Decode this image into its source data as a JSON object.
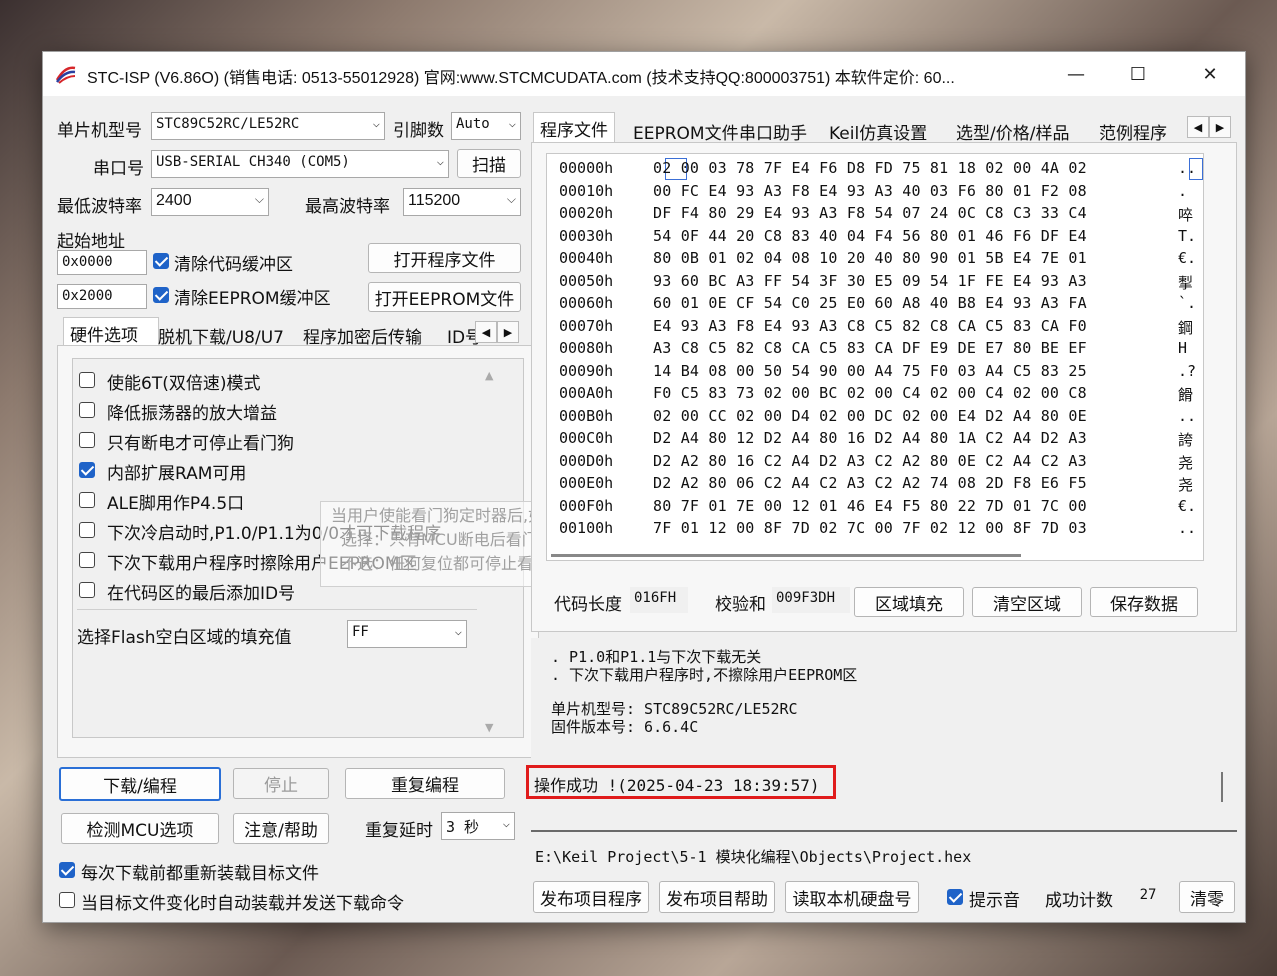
{
  "window": {
    "title": "STC-ISP (V6.86O) (销售电话: 0513-55012928) 官网:www.STCMCUDATA.com  (技术支持QQ:800003751) 本软件定价: 60...",
    "minimize": "—",
    "maximize": "☐",
    "close": "✕"
  },
  "left": {
    "mcu_label": "单片机型号",
    "mcu_value": "STC89C52RC/LE52RC",
    "pins_label": "引脚数",
    "pins_value": "Auto",
    "port_label": "串口号",
    "port_value": "USB-SERIAL CH340 (COM5)",
    "scan_button": "扫描",
    "min_baud_label": "最低波特率",
    "min_baud_value": "2400",
    "max_baud_label": "最高波特率",
    "max_baud_value": "115200",
    "start_addr_label": "起始地址",
    "addr1": "0x0000",
    "clear_code_label": "清除代码缓冲区",
    "open_prog_button": "打开程序文件",
    "addr2": "0x2000",
    "clear_eeprom_label": "清除EEPROM缓冲区",
    "open_eeprom_button": "打开EEPROM文件",
    "tabs": [
      "硬件选项",
      "脱机下载/U8/U7",
      "程序加密后传输",
      "ID号"
    ],
    "options": [
      {
        "label": "使能6T(双倍速)模式",
        "checked": false
      },
      {
        "label": "降低振荡器的放大增益",
        "checked": false
      },
      {
        "label": "只有断电才可停止看门狗",
        "checked": false
      },
      {
        "label": "内部扩展RAM可用",
        "checked": true
      },
      {
        "label": "ALE脚用作P4.5口",
        "checked": false
      },
      {
        "label": "下次冷启动时,P1.0/P1.1为0/0才可下载程序",
        "checked": false
      },
      {
        "label": "下次下载用户程序时擦除用户EEPROM区",
        "checked": false
      },
      {
        "label": "在代码区的最后添加ID号",
        "checked": false
      }
    ],
    "fill_label": "选择Flash空白区域的填充值",
    "fill_value": "FF",
    "tooltip_line1": "当用户使能看门狗定时器后,如何停止看门狗",
    "tooltip_line2": "选择：只有MCU断电后看门狗才停止",
    "tooltip_line3": "不选：任何复位都可停止看门狗",
    "download_button": "下载/编程",
    "stop_button": "停止",
    "reprogram_button": "重复编程",
    "detect_button": "检测MCU选项",
    "help_button": "注意/帮助",
    "delay_label": "重复延时",
    "delay_value": "3 秒",
    "reload_label": "每次下载前都重新装载目标文件",
    "auto_label": "当目标文件变化时自动装载并发送下载命令"
  },
  "right": {
    "tabs": [
      "程序文件",
      "EEPROM文件",
      "串口助手",
      "Keil仿真设置",
      "选型/价格/样品",
      "范例程序"
    ],
    "hex_rows": [
      {
        "addr": "00000h",
        "bytes": "02 00 03 78 7F E4 F6 D8 FD 75 81 18 02 00 4A 02",
        "ascii": ".."
      },
      {
        "addr": "00010h",
        "bytes": "00 FC E4 93 A3 F8 E4 93 A3 40 03 F6 80 01 F2 08",
        "ascii": "."
      },
      {
        "addr": "00020h",
        "bytes": "DF F4 80 29 E4 93 A3 F8 54 07 24 0C C8 C3 33 C4",
        "ascii": "啐"
      },
      {
        "addr": "00030h",
        "bytes": "54 0F 44 20 C8 83 40 04 F4 56 80 01 46 F6 DF E4",
        "ascii": "T."
      },
      {
        "addr": "00040h",
        "bytes": "80 0B 01 02 04 08 10 20 40 80 90 01 5B E4 7E 01",
        "ascii": "€."
      },
      {
        "addr": "00050h",
        "bytes": "93 60 BC A3 FF 54 3F 30 E5 09 54 1F FE E4 93 A3",
        "ascii": "揧"
      },
      {
        "addr": "00060h",
        "bytes": "60 01 0E CF 54 C0 25 E0 60 A8 40 B8 E4 93 A3 FA",
        "ascii": "`."
      },
      {
        "addr": "00070h",
        "bytes": "E4 93 A3 F8 E4 93 A3 C8 C5 82 C8 CA C5 83 CA F0",
        "ascii": "鋼"
      },
      {
        "addr": "00080h",
        "bytes": "A3 C8 C5 82 C8 CA C5 83 CA DF E9 DE E7 80 BE EF",
        "ascii": "H"
      },
      {
        "addr": "00090h",
        "bytes": "14 B4 08 00 50 54 90 00 A4 75 F0 03 A4 C5 83 25",
        "ascii": ".?"
      },
      {
        "addr": "000A0h",
        "bytes": "F0 C5 83 73 02 00 BC 02 00 C4 02 00 C4 02 00 C8",
        "ascii": "餶"
      },
      {
        "addr": "000B0h",
        "bytes": "02 00 CC 02 00 D4 02 00 DC 02 00 E4 D2 A4 80 0E",
        "ascii": ".."
      },
      {
        "addr": "000C0h",
        "bytes": "D2 A4 80 12 D2 A4 80 16 D2 A4 80 1A C2 A4 D2 A3",
        "ascii": "誇"
      },
      {
        "addr": "000D0h",
        "bytes": "D2 A2 80 16 C2 A4 D2 A3 C2 A2 80 0E C2 A4 C2 A3",
        "ascii": "尧"
      },
      {
        "addr": "000E0h",
        "bytes": "D2 A2 80 06 C2 A4 C2 A3 C2 A2 74 08 2D F8 E6 F5",
        "ascii": "尧"
      },
      {
        "addr": "000F0h",
        "bytes": "80 7F 01 7E 00 12 01 46 E4 F5 80 22 7D 01 7C 00",
        "ascii": "€."
      },
      {
        "addr": "00100h",
        "bytes": "7F 01 12 00 8F 7D 02 7C 00 7F 02 12 00 8F 7D 03",
        "ascii": ".."
      }
    ],
    "code_len_label": "代码长度",
    "code_len_value": "016FH",
    "checksum_label": "校验和",
    "checksum_value": "009F3DH",
    "fill_area_button": "区域填充",
    "clear_area_button": "清空区域",
    "save_data_button": "保存数据",
    "log_line1": ". P1.0和P1.1与下次下载无关",
    "log_line2": ". 下次下载用户程序时,不擦除用户EEPROM区",
    "log_line3": "单片机型号: STC89C52RC/LE52RC",
    "log_line4": "固件版本号: 6.6.4C",
    "status": "操作成功 !(2025-04-23 18:39:57)",
    "status_highlight_color": "#e01b1b",
    "file_path": "E:\\Keil Project\\5-1 模块化编程\\Objects\\Project.hex",
    "publish_button": "发布项目程序",
    "publish_help_button": "发布项目帮助",
    "read_disk_button": "读取本机硬盘号",
    "beep_label": "提示音",
    "count_label": "成功计数",
    "count_value": "27",
    "reset_button": "清零"
  }
}
